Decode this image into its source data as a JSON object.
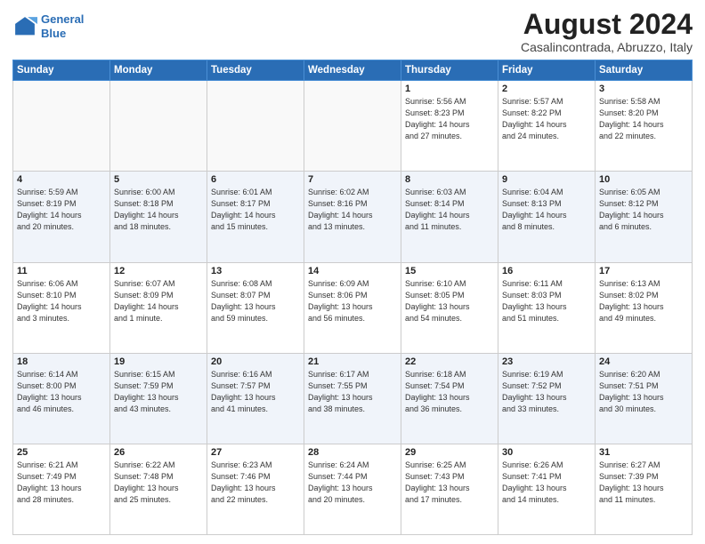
{
  "logo": {
    "line1": "General",
    "line2": "Blue"
  },
  "header": {
    "month_year": "August 2024",
    "location": "Casalincontrada, Abruzzo, Italy"
  },
  "weekdays": [
    "Sunday",
    "Monday",
    "Tuesday",
    "Wednesday",
    "Thursday",
    "Friday",
    "Saturday"
  ],
  "weeks": [
    [
      {
        "day": "",
        "info": ""
      },
      {
        "day": "",
        "info": ""
      },
      {
        "day": "",
        "info": ""
      },
      {
        "day": "",
        "info": ""
      },
      {
        "day": "1",
        "info": "Sunrise: 5:56 AM\nSunset: 8:23 PM\nDaylight: 14 hours\nand 27 minutes."
      },
      {
        "day": "2",
        "info": "Sunrise: 5:57 AM\nSunset: 8:22 PM\nDaylight: 14 hours\nand 24 minutes."
      },
      {
        "day": "3",
        "info": "Sunrise: 5:58 AM\nSunset: 8:20 PM\nDaylight: 14 hours\nand 22 minutes."
      }
    ],
    [
      {
        "day": "4",
        "info": "Sunrise: 5:59 AM\nSunset: 8:19 PM\nDaylight: 14 hours\nand 20 minutes."
      },
      {
        "day": "5",
        "info": "Sunrise: 6:00 AM\nSunset: 8:18 PM\nDaylight: 14 hours\nand 18 minutes."
      },
      {
        "day": "6",
        "info": "Sunrise: 6:01 AM\nSunset: 8:17 PM\nDaylight: 14 hours\nand 15 minutes."
      },
      {
        "day": "7",
        "info": "Sunrise: 6:02 AM\nSunset: 8:16 PM\nDaylight: 14 hours\nand 13 minutes."
      },
      {
        "day": "8",
        "info": "Sunrise: 6:03 AM\nSunset: 8:14 PM\nDaylight: 14 hours\nand 11 minutes."
      },
      {
        "day": "9",
        "info": "Sunrise: 6:04 AM\nSunset: 8:13 PM\nDaylight: 14 hours\nand 8 minutes."
      },
      {
        "day": "10",
        "info": "Sunrise: 6:05 AM\nSunset: 8:12 PM\nDaylight: 14 hours\nand 6 minutes."
      }
    ],
    [
      {
        "day": "11",
        "info": "Sunrise: 6:06 AM\nSunset: 8:10 PM\nDaylight: 14 hours\nand 3 minutes."
      },
      {
        "day": "12",
        "info": "Sunrise: 6:07 AM\nSunset: 8:09 PM\nDaylight: 14 hours\nand 1 minute."
      },
      {
        "day": "13",
        "info": "Sunrise: 6:08 AM\nSunset: 8:07 PM\nDaylight: 13 hours\nand 59 minutes."
      },
      {
        "day": "14",
        "info": "Sunrise: 6:09 AM\nSunset: 8:06 PM\nDaylight: 13 hours\nand 56 minutes."
      },
      {
        "day": "15",
        "info": "Sunrise: 6:10 AM\nSunset: 8:05 PM\nDaylight: 13 hours\nand 54 minutes."
      },
      {
        "day": "16",
        "info": "Sunrise: 6:11 AM\nSunset: 8:03 PM\nDaylight: 13 hours\nand 51 minutes."
      },
      {
        "day": "17",
        "info": "Sunrise: 6:13 AM\nSunset: 8:02 PM\nDaylight: 13 hours\nand 49 minutes."
      }
    ],
    [
      {
        "day": "18",
        "info": "Sunrise: 6:14 AM\nSunset: 8:00 PM\nDaylight: 13 hours\nand 46 minutes."
      },
      {
        "day": "19",
        "info": "Sunrise: 6:15 AM\nSunset: 7:59 PM\nDaylight: 13 hours\nand 43 minutes."
      },
      {
        "day": "20",
        "info": "Sunrise: 6:16 AM\nSunset: 7:57 PM\nDaylight: 13 hours\nand 41 minutes."
      },
      {
        "day": "21",
        "info": "Sunrise: 6:17 AM\nSunset: 7:55 PM\nDaylight: 13 hours\nand 38 minutes."
      },
      {
        "day": "22",
        "info": "Sunrise: 6:18 AM\nSunset: 7:54 PM\nDaylight: 13 hours\nand 36 minutes."
      },
      {
        "day": "23",
        "info": "Sunrise: 6:19 AM\nSunset: 7:52 PM\nDaylight: 13 hours\nand 33 minutes."
      },
      {
        "day": "24",
        "info": "Sunrise: 6:20 AM\nSunset: 7:51 PM\nDaylight: 13 hours\nand 30 minutes."
      }
    ],
    [
      {
        "day": "25",
        "info": "Sunrise: 6:21 AM\nSunset: 7:49 PM\nDaylight: 13 hours\nand 28 minutes."
      },
      {
        "day": "26",
        "info": "Sunrise: 6:22 AM\nSunset: 7:48 PM\nDaylight: 13 hours\nand 25 minutes."
      },
      {
        "day": "27",
        "info": "Sunrise: 6:23 AM\nSunset: 7:46 PM\nDaylight: 13 hours\nand 22 minutes."
      },
      {
        "day": "28",
        "info": "Sunrise: 6:24 AM\nSunset: 7:44 PM\nDaylight: 13 hours\nand 20 minutes."
      },
      {
        "day": "29",
        "info": "Sunrise: 6:25 AM\nSunset: 7:43 PM\nDaylight: 13 hours\nand 17 minutes."
      },
      {
        "day": "30",
        "info": "Sunrise: 6:26 AM\nSunset: 7:41 PM\nDaylight: 13 hours\nand 14 minutes."
      },
      {
        "day": "31",
        "info": "Sunrise: 6:27 AM\nSunset: 7:39 PM\nDaylight: 13 hours\nand 11 minutes."
      }
    ]
  ]
}
